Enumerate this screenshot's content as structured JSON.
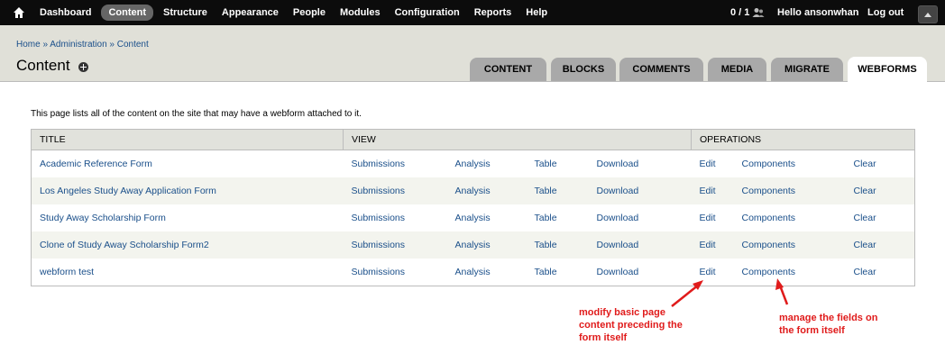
{
  "toolbar": {
    "nav": [
      "Dashboard",
      "Content",
      "Structure",
      "Appearance",
      "People",
      "Modules",
      "Configuration",
      "Reports",
      "Help"
    ],
    "active": "Content",
    "counter": "0 / 1",
    "hello_prefix": "Hello ",
    "username": "ansonwhan",
    "logout": "Log out"
  },
  "header": {
    "breadcrumb": [
      "Home",
      "Administration",
      "Content"
    ],
    "breadcrumb_sep": " » ",
    "title": "Content",
    "tabs": [
      "Content",
      "Blocks",
      "Comments",
      "Media",
      "Migrate",
      "Webforms"
    ],
    "active_tab": "Webforms"
  },
  "description": "This page lists all of the content on the site that may have a webform attached to it.",
  "table": {
    "headers": {
      "title": "TITLE",
      "view": "VIEW",
      "operations": "OPERATIONS"
    },
    "rows": [
      {
        "title": "Academic Reference Form",
        "submissions": "Submissions",
        "analysis": "Analysis",
        "table": "Table",
        "download": "Download",
        "edit": "Edit",
        "components": "Components",
        "clear": "Clear"
      },
      {
        "title": "Los Angeles Study Away Application Form",
        "submissions": "Submissions",
        "analysis": "Analysis",
        "table": "Table",
        "download": "Download",
        "edit": "Edit",
        "components": "Components",
        "clear": "Clear"
      },
      {
        "title": "Study Away Scholarship Form",
        "submissions": "Submissions",
        "analysis": "Analysis",
        "table": "Table",
        "download": "Download",
        "edit": "Edit",
        "components": "Components",
        "clear": "Clear"
      },
      {
        "title": "Clone of Study Away Scholarship Form2",
        "submissions": "Submissions",
        "analysis": "Analysis",
        "table": "Table",
        "download": "Download",
        "edit": "Edit",
        "components": "Components",
        "clear": "Clear"
      },
      {
        "title": "webform test",
        "submissions": "Submissions",
        "analysis": "Analysis",
        "table": "Table",
        "download": "Download",
        "edit": "Edit",
        "components": "Components",
        "clear": "Clear"
      }
    ]
  },
  "annotations": {
    "edit_note": [
      "modify basic page",
      "content preceding the",
      "form itself"
    ],
    "components_note": [
      "manage the fields on",
      "the form itself"
    ],
    "color": "#e01b1b"
  },
  "colors": {
    "toolbar": "#0c0c0c",
    "link": "#1a4f8a",
    "header_bg": "#e0e0d8",
    "tab_bg": "#a9a9a9"
  }
}
